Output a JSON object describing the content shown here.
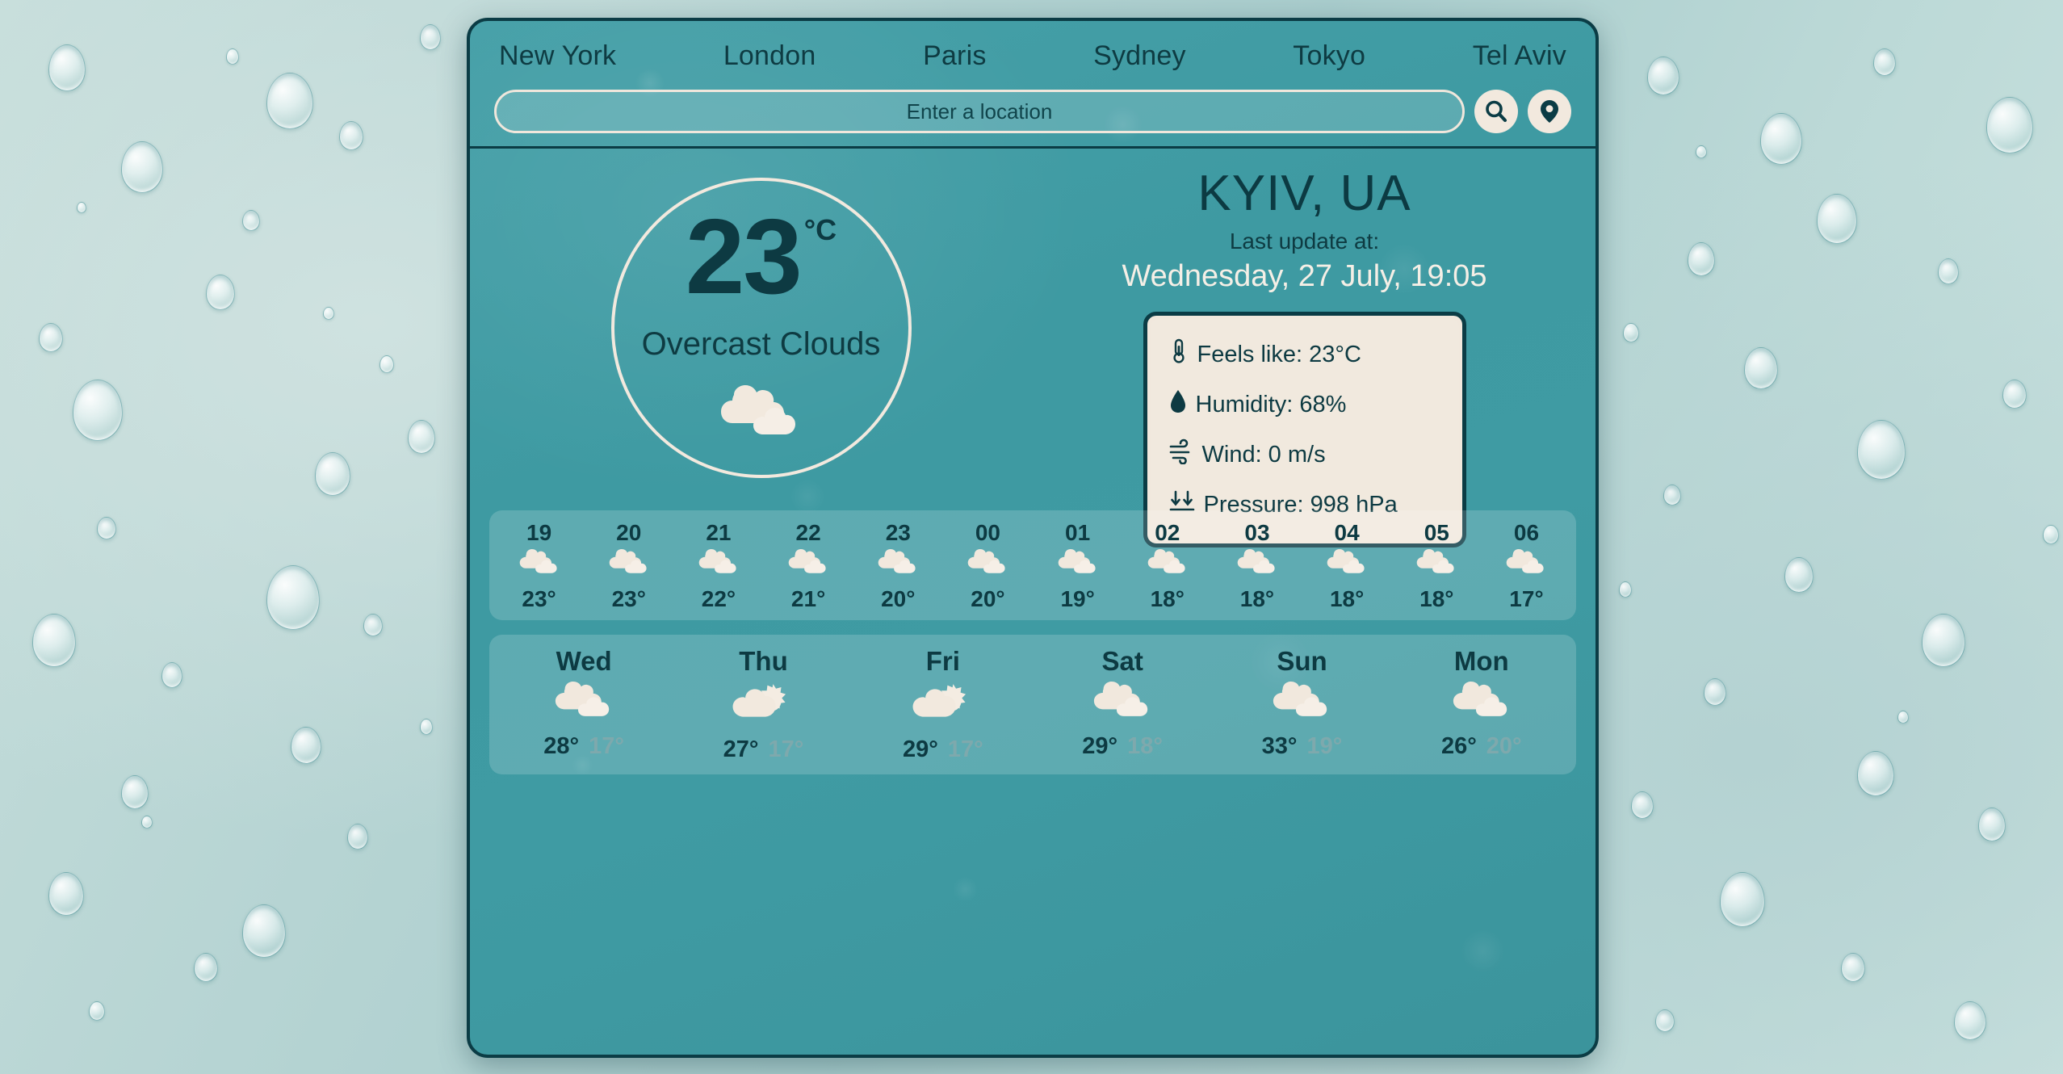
{
  "colors": {
    "card_bg": "#3f9ba3",
    "border_dark": "#0b3c45",
    "cream": "#f2e9de",
    "text_dark": "#0d3a42",
    "text_muted": "#7ea9ad"
  },
  "city_tabs": [
    {
      "label": "New York"
    },
    {
      "label": "London"
    },
    {
      "label": "Paris"
    },
    {
      "label": "Sydney"
    },
    {
      "label": "Tokyo"
    },
    {
      "label": "Tel Aviv"
    }
  ],
  "search": {
    "placeholder": "Enter a location",
    "value": "",
    "search_icon": "search-icon",
    "location_icon": "map-pin-icon"
  },
  "current": {
    "temperature": "23",
    "unit": "°C",
    "condition": "Overcast Clouds",
    "icon": "overcast-clouds-icon",
    "city": "KYIV, UA",
    "last_update_label": "Last update at:",
    "last_update_value": "Wednesday, 27 July, 19:05"
  },
  "details": [
    {
      "icon": "thermometer-icon",
      "text": "Feels like: 23°C"
    },
    {
      "icon": "droplet-icon",
      "text": "Humidity: 68%"
    },
    {
      "icon": "wind-icon",
      "text": "Wind: 0 m/s"
    },
    {
      "icon": "pressure-icon",
      "text": "Pressure: 998 hPa"
    }
  ],
  "hourly": [
    {
      "time": "19",
      "icon": "overcast-clouds-icon",
      "temp": "23°"
    },
    {
      "time": "20",
      "icon": "overcast-clouds-icon",
      "temp": "23°"
    },
    {
      "time": "21",
      "icon": "overcast-clouds-icon",
      "temp": "22°"
    },
    {
      "time": "22",
      "icon": "overcast-clouds-icon",
      "temp": "21°"
    },
    {
      "time": "23",
      "icon": "overcast-clouds-icon",
      "temp": "20°"
    },
    {
      "time": "00",
      "icon": "overcast-clouds-icon",
      "temp": "20°"
    },
    {
      "time": "01",
      "icon": "overcast-clouds-icon",
      "temp": "19°"
    },
    {
      "time": "02",
      "icon": "overcast-clouds-icon",
      "temp": "18°"
    },
    {
      "time": "03",
      "icon": "overcast-clouds-icon",
      "temp": "18°"
    },
    {
      "time": "04",
      "icon": "overcast-clouds-icon",
      "temp": "18°"
    },
    {
      "time": "05",
      "icon": "overcast-clouds-icon",
      "temp": "18°"
    },
    {
      "time": "06",
      "icon": "overcast-clouds-icon",
      "temp": "17°"
    }
  ],
  "daily": [
    {
      "day": "Wed",
      "icon": "overcast-clouds-icon",
      "max": "28°",
      "min": "17°"
    },
    {
      "day": "Thu",
      "icon": "sun-behind-cloud-icon",
      "max": "27°",
      "min": "17°"
    },
    {
      "day": "Fri",
      "icon": "sun-behind-cloud-icon",
      "max": "29°",
      "min": "17°"
    },
    {
      "day": "Sat",
      "icon": "overcast-clouds-icon",
      "max": "29°",
      "min": "18°"
    },
    {
      "day": "Sun",
      "icon": "overcast-clouds-icon",
      "max": "33°",
      "min": "19°"
    },
    {
      "day": "Mon",
      "icon": "overcast-clouds-icon",
      "max": "26°",
      "min": "20°"
    }
  ]
}
